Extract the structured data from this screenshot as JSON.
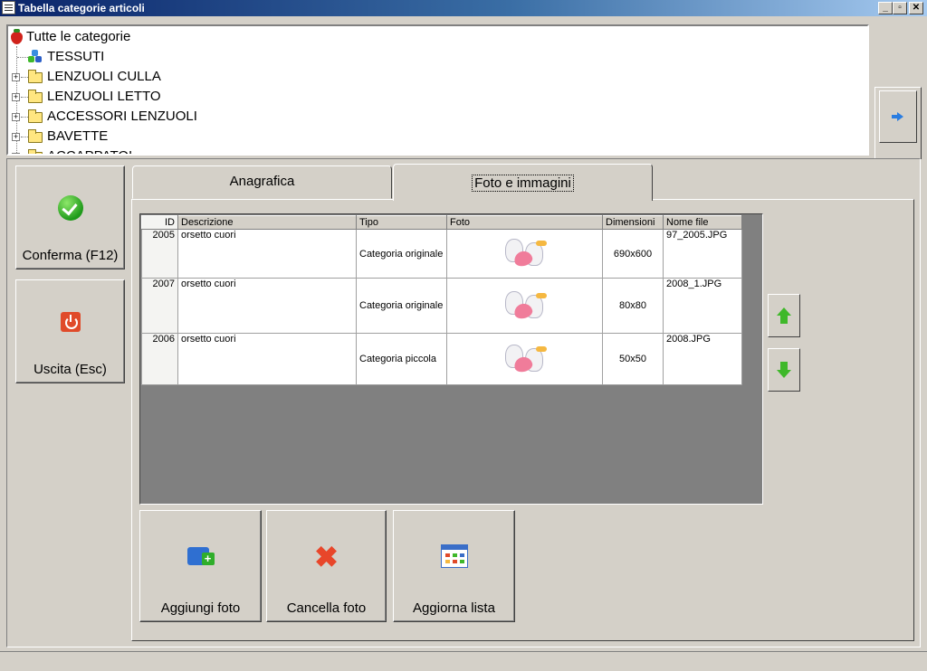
{
  "window": {
    "title": "Tabella categorie articoli",
    "minimize": "_",
    "restore": "▫",
    "close": "✕"
  },
  "tree": {
    "root": "Tutte le categorie",
    "items": [
      {
        "label": "TESSUTI",
        "icon": "fabric-icon",
        "expandable": false
      },
      {
        "label": "LENZUOLI CULLA",
        "icon": "folder-icon",
        "expandable": true
      },
      {
        "label": "LENZUOLI LETTO",
        "icon": "folder-icon",
        "expandable": true
      },
      {
        "label": "ACCESSORI LENZUOLI",
        "icon": "folder-icon",
        "expandable": true
      },
      {
        "label": "BAVETTE",
        "icon": "folder-icon",
        "expandable": true
      },
      {
        "label": "ACCAPPATOI",
        "icon": "folder-icon",
        "expandable": true
      }
    ]
  },
  "side": {
    "confirm_label": "Conferma (F12)",
    "exit_label": "Uscita (Esc)"
  },
  "tabs": [
    {
      "label": "Anagrafica",
      "active": false
    },
    {
      "label": "Foto e immagini",
      "active": true
    }
  ],
  "grid": {
    "columns": [
      "ID",
      "Descrizione",
      "Tipo",
      "Foto",
      "Dimensioni",
      "Nome file"
    ],
    "rows": [
      {
        "id": "2005",
        "descrizione": "orsetto cuori",
        "tipo": "Categoria originale",
        "dimensioni": "690x600",
        "nome_file": "97_2005.JPG"
      },
      {
        "id": "2007",
        "descrizione": "orsetto cuori",
        "tipo": "Categoria originale",
        "dimensioni": "80x80",
        "nome_file": "2008_1.JPG"
      },
      {
        "id": "2006",
        "descrizione": "orsetto cuori",
        "tipo": "Categoria piccola",
        "dimensioni": "50x50",
        "nome_file": "2008.JPG"
      }
    ]
  },
  "actions": {
    "add_label": "Aggiungi foto",
    "delete_label": "Cancella foto",
    "refresh_label": "Aggiorna lista"
  },
  "colors": {
    "title_gradient_start": "#0a246a",
    "face": "#d4d0c8",
    "grid_background": "#808080",
    "accent_green": "#3fb82a"
  }
}
